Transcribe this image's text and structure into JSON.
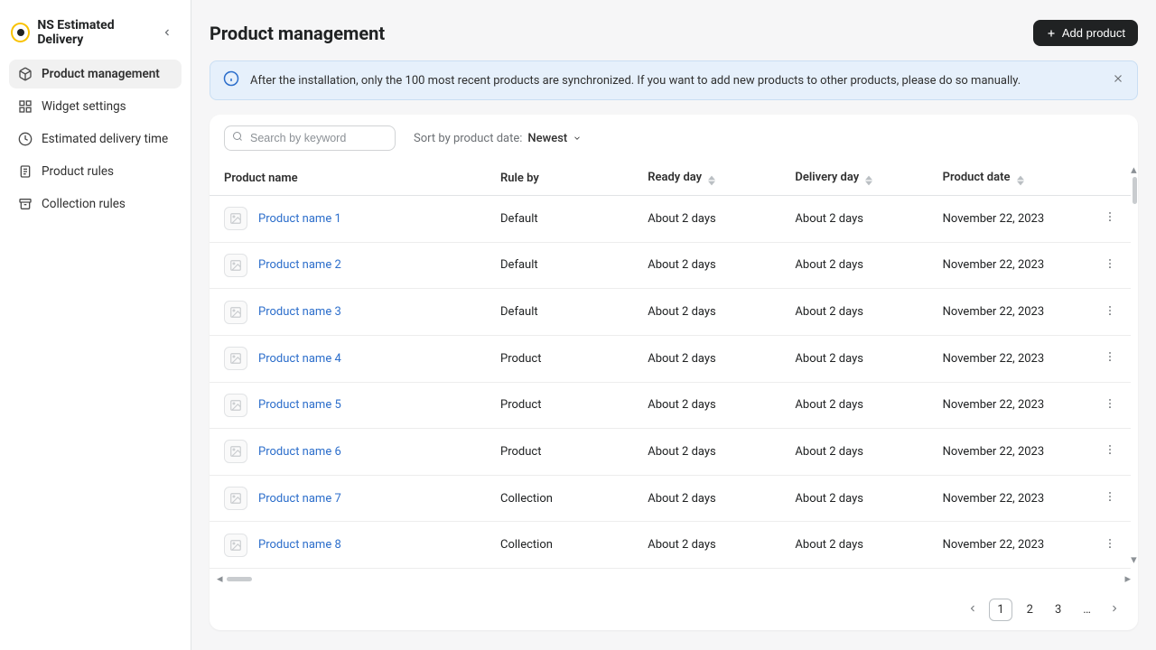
{
  "brand": "NS Estimated Delivery",
  "nav": {
    "items": [
      {
        "label": "Product management"
      },
      {
        "label": "Widget settings"
      },
      {
        "label": "Estimated delivery time"
      },
      {
        "label": "Product rules"
      },
      {
        "label": "Collection rules"
      }
    ]
  },
  "page": {
    "title": "Product management",
    "add_button": "Add product"
  },
  "banner": {
    "text": "After the installation, only the 100 most recent products are synchronized. If you want to add new products to other products, please do so manually."
  },
  "search": {
    "placeholder": "Search by keyword"
  },
  "sort": {
    "label": "Sort by product date:",
    "value": "Newest"
  },
  "table": {
    "headers": {
      "name": "Product name",
      "rule": "Rule by",
      "ready": "Ready day",
      "delivery": "Delivery day",
      "date": "Product date"
    },
    "rows": [
      {
        "name": "Product name 1",
        "rule": "Default",
        "ready": "About 2 days",
        "delivery": "About 2 days",
        "date": "November 22, 2023"
      },
      {
        "name": "Product name 2",
        "rule": "Default",
        "ready": "About 2 days",
        "delivery": "About 2 days",
        "date": "November 22, 2023"
      },
      {
        "name": "Product name 3",
        "rule": "Default",
        "ready": "About 2 days",
        "delivery": "About 2 days",
        "date": "November 22, 2023"
      },
      {
        "name": "Product name 4",
        "rule": "Product",
        "ready": "About 2 days",
        "delivery": "About 2 days",
        "date": "November 22, 2023"
      },
      {
        "name": "Product name 5",
        "rule": "Product",
        "ready": "About 2 days",
        "delivery": "About 2 days",
        "date": "November 22, 2023"
      },
      {
        "name": "Product name 6",
        "rule": "Product",
        "ready": "About 2 days",
        "delivery": "About 2 days",
        "date": "November 22, 2023"
      },
      {
        "name": "Product name 7",
        "rule": "Collection",
        "ready": "About 2 days",
        "delivery": "About 2 days",
        "date": "November 22, 2023"
      },
      {
        "name": "Product name 8",
        "rule": "Collection",
        "ready": "About 2 days",
        "delivery": "About 2 days",
        "date": "November 22, 2023"
      }
    ]
  },
  "pagination": {
    "pages": [
      "1",
      "2",
      "3"
    ],
    "ellipsis": "…"
  }
}
